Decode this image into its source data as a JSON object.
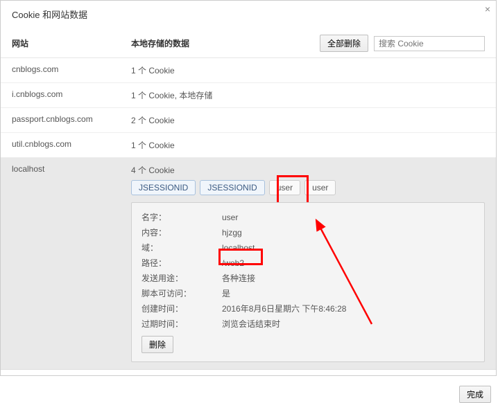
{
  "title": "Cookie 和网站数据",
  "header": {
    "site_col": "网站",
    "data_col": "本地存储的数据",
    "delete_all": "全部删除",
    "search_placeholder": "搜索 Cookie"
  },
  "rows": [
    {
      "site": "cnblogs.com",
      "data": "1 个 Cookie"
    },
    {
      "site": "i.cnblogs.com",
      "data": "1 个 Cookie, 本地存储"
    },
    {
      "site": "passport.cnblogs.com",
      "data": "2 个 Cookie"
    },
    {
      "site": "util.cnblogs.com",
      "data": "1 个 Cookie"
    }
  ],
  "selected": {
    "site": "localhost",
    "data": "4 个 Cookie",
    "pills": {
      "p0": "JSESSIONID",
      "p1": "JSESSIONID",
      "p2": "user",
      "p3": "user"
    },
    "details": {
      "labels": {
        "name": "名字：",
        "content": "内容：",
        "domain": "域：",
        "path": "路径：",
        "send": "发送用途：",
        "script": "脚本可访问：",
        "created": "创建时间：",
        "expires": "过期时间："
      },
      "values": {
        "name": "user",
        "content": "hjzgg",
        "domain": "localhost",
        "path": "/web2",
        "send": "各种连接",
        "script": "是",
        "created": "2016年8月6日星期六 下午8:46:28",
        "expires": "浏览会话结束时"
      },
      "delete": "删除"
    }
  },
  "footer": {
    "done": "完成"
  }
}
